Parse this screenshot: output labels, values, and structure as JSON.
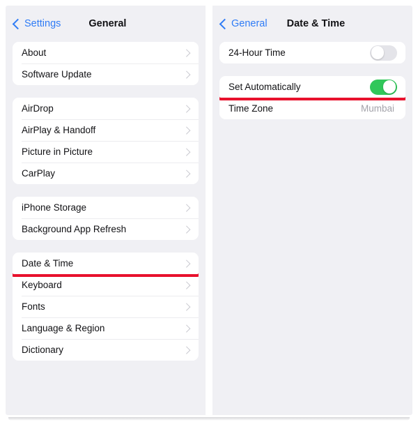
{
  "theme": {
    "accent_blue": "#2F7CF6",
    "toggle_on_green": "#31C75A",
    "toggle_off_gray": "#E4E4E9",
    "highlight_red": "#E8112D",
    "panel_bg": "#F0F0F4",
    "card_bg": "#FFFFFF",
    "value_gray": "#A3A3AA"
  },
  "left_panel": {
    "nav": {
      "back_label": "Settings",
      "back_icon": "chevron-left-icon",
      "title": "General"
    },
    "sections": [
      {
        "id": "section-info",
        "rows": [
          {
            "label": "About",
            "accessory": "chevron-right-icon",
            "highlighted": false
          },
          {
            "label": "Software Update",
            "accessory": "chevron-right-icon",
            "highlighted": false
          }
        ]
      },
      {
        "id": "section-connectivity",
        "rows": [
          {
            "label": "AirDrop",
            "accessory": "chevron-right-icon",
            "highlighted": false
          },
          {
            "label": "AirPlay & Handoff",
            "accessory": "chevron-right-icon",
            "highlighted": false
          },
          {
            "label": "Picture in Picture",
            "accessory": "chevron-right-icon",
            "highlighted": false
          },
          {
            "label": "CarPlay",
            "accessory": "chevron-right-icon",
            "highlighted": false
          }
        ]
      },
      {
        "id": "section-storage",
        "rows": [
          {
            "label": "iPhone Storage",
            "accessory": "chevron-right-icon",
            "highlighted": false
          },
          {
            "label": "Background App Refresh",
            "accessory": "chevron-right-icon",
            "highlighted": false
          }
        ]
      },
      {
        "id": "section-localization",
        "rows": [
          {
            "label": "Date & Time",
            "accessory": "chevron-right-icon",
            "highlighted": true
          },
          {
            "label": "Keyboard",
            "accessory": "chevron-right-icon",
            "highlighted": false
          },
          {
            "label": "Fonts",
            "accessory": "chevron-right-icon",
            "highlighted": false
          },
          {
            "label": "Language & Region",
            "accessory": "chevron-right-icon",
            "highlighted": false
          },
          {
            "label": "Dictionary",
            "accessory": "chevron-right-icon",
            "highlighted": false
          }
        ]
      }
    ]
  },
  "right_panel": {
    "nav": {
      "back_label": "General",
      "back_icon": "chevron-left-icon",
      "title": "Date & Time"
    },
    "sections": [
      {
        "id": "section-hour-format",
        "rows": [
          {
            "label": "24-Hour Time",
            "accessory": "toggle",
            "toggle_state": "off",
            "highlighted": false
          }
        ]
      },
      {
        "id": "section-auto-time",
        "rows": [
          {
            "label": "Set Automatically",
            "accessory": "toggle",
            "toggle_state": "on",
            "highlighted": true
          },
          {
            "label": "Time Zone",
            "accessory": "value",
            "value": "Mumbai",
            "highlighted": false
          }
        ]
      }
    ]
  }
}
